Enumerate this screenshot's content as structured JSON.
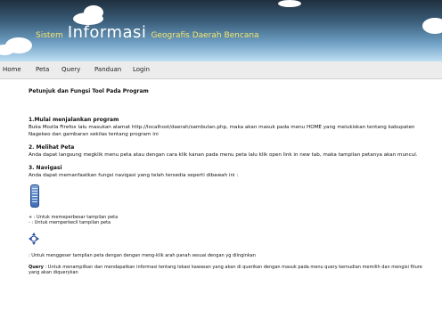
{
  "banner": {
    "title_prefix": "Sistem",
    "title_main": "Informasi",
    "title_suffix": "Geografis Daerah Bencana"
  },
  "nav": {
    "items": [
      "Home",
      "Peta",
      "Query",
      "Panduan",
      "Login"
    ]
  },
  "page": {
    "heading": "Petunjuk dan Fungsi Tool Pada Program",
    "s1_title": "1.Mulai menjalankan program",
    "s1_text": "Buka Mozila Firefox lalu masukan alamat http://localhost/daerah/sambutan.php, maka akan masuk pada menu HOME yang melukiskan tentang kabupaten Nagekeo dan gambaran sekilas tentang program ini",
    "s2_title": "2. Melihat Peta",
    "s2_text": "Anda dapat langsung megklik menu peta atau dengan cara klik kanan pada menu peta lalu klik open link in new tab, maka tampilan petanya akan muncul.",
    "s3_title": "3. Navigasi",
    "s3_text": "Anda dapat memanfaatkan fungsi navigasi yang telah tersedia seperti dibawah ini :",
    "zoom_in": "+ : Untuk memeperbesar tampilan peta",
    "zoom_out": "- : Untuk memperkecil tampilan peta",
    "pan_text": ": Untuk menggeser tampilan peta dengan dengan meng-klik arah panah sesuai dengan yg diinginkan",
    "query_label": "Query",
    "query_text": " : Untuk menampilkan dan mendapatkan informasi tentang lokasi kawasan yang akan di querikan dengan masuk pada menu query kemudian memilih dan mengisi fiture yang akan diquerykan"
  }
}
